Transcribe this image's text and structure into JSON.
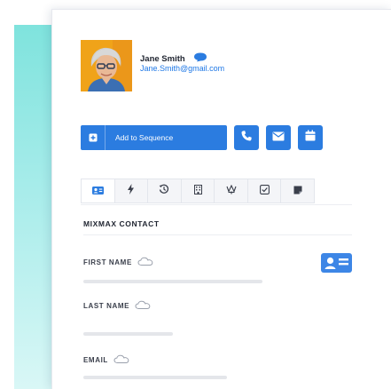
{
  "contact": {
    "name": "Jane Smith",
    "email": "Jane.Smith@gmail.com"
  },
  "actions": {
    "add_to_sequence": "Add to Sequence"
  },
  "tabs": [
    {
      "icon": "contact-card-icon",
      "active": true
    },
    {
      "icon": "lightning-icon",
      "active": false
    },
    {
      "icon": "history-icon",
      "active": false
    },
    {
      "icon": "building-icon",
      "active": false
    },
    {
      "icon": "crown-icon",
      "active": false
    },
    {
      "icon": "checkbox-icon",
      "active": false
    },
    {
      "icon": "note-icon",
      "active": false
    }
  ],
  "section": {
    "title": "MIXMAX CONTACT"
  },
  "fields": [
    {
      "label": "FIRST NAME"
    },
    {
      "label": "LAST NAME"
    },
    {
      "label": "EMAIL"
    }
  ],
  "colors": {
    "accent": "#2b7ce0",
    "link": "#1f78e6",
    "avatar_bg": "#f0a319"
  }
}
